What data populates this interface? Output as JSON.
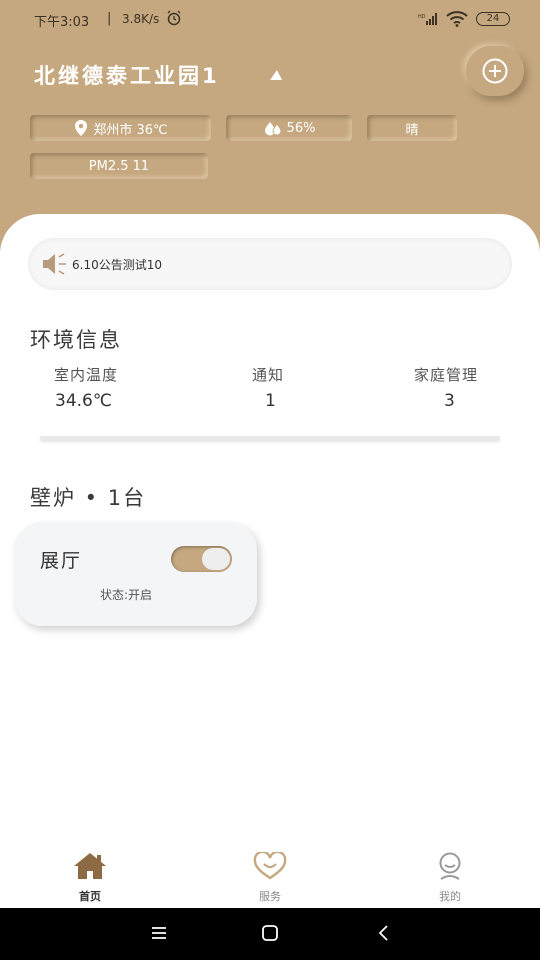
{
  "status_bar": {
    "time": "下午3:03",
    "separator": "|",
    "net_speed": "3.8K/s",
    "battery": "24"
  },
  "header": {
    "location": "北继德泰工业园1",
    "city_temp": "郑州市 36℃",
    "humidity": "56%",
    "weather": "晴",
    "pm25": "PM2.5 11"
  },
  "notice": {
    "text": "6.10公告测试10"
  },
  "environment": {
    "title": "环境信息",
    "items": [
      {
        "label": "室内温度",
        "value": "34.6℃"
      },
      {
        "label": "通知",
        "value": "1"
      },
      {
        "label": "家庭管理",
        "value": "3"
      }
    ]
  },
  "fireplace": {
    "title": "壁炉 • 1台",
    "devices": [
      {
        "name": "展厅",
        "status": "状态:开启",
        "on": true
      }
    ]
  },
  "bottom_nav": {
    "items": [
      {
        "label": "首页",
        "icon": "home-icon",
        "active": true
      },
      {
        "label": "服务",
        "icon": "heart-smile-icon",
        "active": false
      },
      {
        "label": "我的",
        "icon": "profile-icon",
        "active": false
      }
    ]
  },
  "colors": {
    "accent": "#c5a880",
    "card_bg": "#f4f5f6"
  }
}
